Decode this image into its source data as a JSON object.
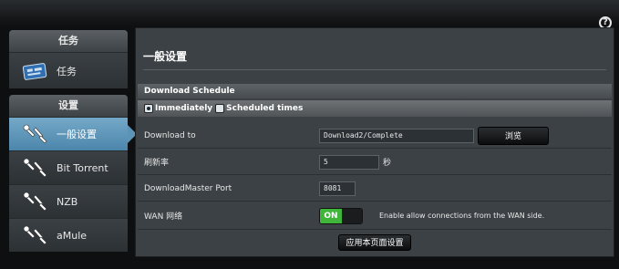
{
  "help": {
    "icon": "help-icon",
    "glyph": "?"
  },
  "sidebar": {
    "group1": {
      "header": "任务",
      "items": [
        {
          "label": "任务",
          "icon": "task-icon"
        }
      ]
    },
    "group2": {
      "header": "设置",
      "items": [
        {
          "label": "一般设置",
          "icon": "wrench-icon",
          "active": true
        },
        {
          "label": "Bit Torrent",
          "icon": "wrench-icon"
        },
        {
          "label": "NZB",
          "icon": "wrench-icon"
        },
        {
          "label": "aMule",
          "icon": "wrench-icon"
        }
      ]
    }
  },
  "main": {
    "title": "一般设置",
    "schedule": {
      "header": "Download Schedule",
      "option_immediately": "Immediately",
      "option_scheduled": "Scheduled times",
      "selected": "Immediately"
    },
    "rows": {
      "download_to": {
        "label": "Download to",
        "value": "Download2/Complete",
        "browse": "浏览"
      },
      "refresh": {
        "label": "刷新率",
        "value": "5",
        "unit": "秒"
      },
      "port": {
        "label": "DownloadMaster Port",
        "value": "8081"
      },
      "wan": {
        "label": "WAN 网络",
        "toggle": "ON",
        "desc": "Enable allow connections from the WAN side."
      }
    },
    "apply": "应用本页面设置"
  },
  "colors": {
    "active": "#5c93b6",
    "toggle_on": "#3fb53a"
  }
}
